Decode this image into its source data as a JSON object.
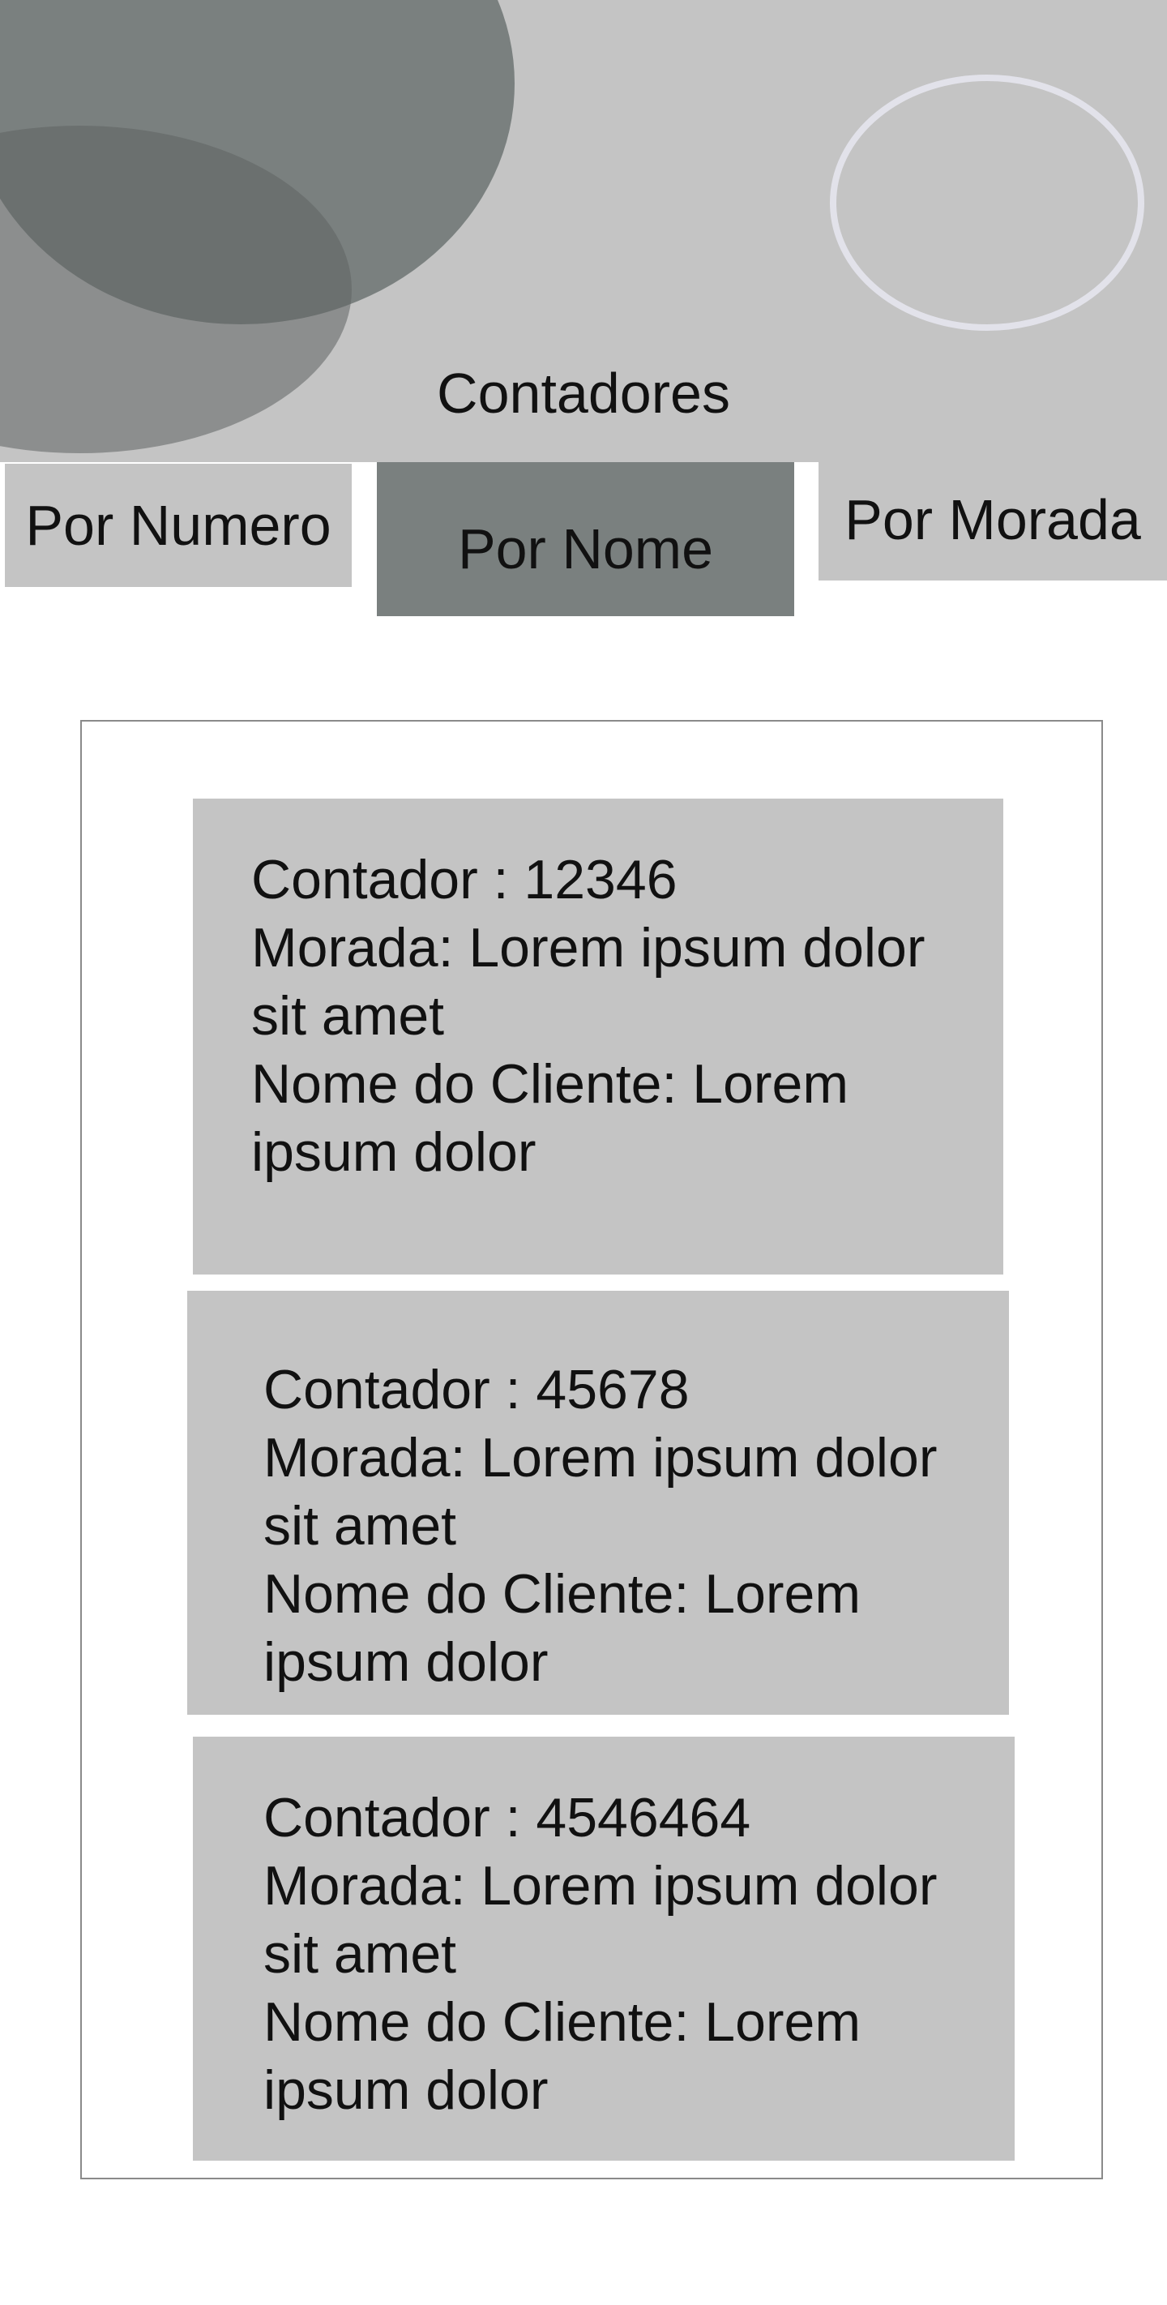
{
  "header": {
    "title": "Contadores"
  },
  "tabs": [
    {
      "label": "Por Numero",
      "active": false
    },
    {
      "label": "Por Nome",
      "active": true
    },
    {
      "label": "Por Morada",
      "active": false
    }
  ],
  "colors": {
    "header_bg": "#c4c4c4",
    "active_tab": "#7a807f",
    "card_bg": "#c4c4c4",
    "circle_dark": "#7a807f",
    "circle_darker": "#5b5f5f",
    "circle_outline": "#e2e2ea"
  },
  "cards": [
    {
      "counter": "Contador : 12346",
      "address_1": "Morada: Lorem ipsum dolor",
      "address_2": "sit amet",
      "client_1": "Nome do Cliente: Lorem",
      "client_2": "ipsum dolor"
    },
    {
      "counter": "Contador : 45678",
      "address_1": "Morada: Lorem ipsum dolor",
      "address_2": "sit amet",
      "client_1": "Nome do Cliente: Lorem",
      "client_2": "ipsum dolor"
    },
    {
      "counter": "Contador : 4546464",
      "address_1": "Morada: Lorem ipsum dolor",
      "address_2": "sit amet",
      "client_1": "Nome do Cliente: Lorem",
      "client_2": "ipsum dolor"
    }
  ]
}
